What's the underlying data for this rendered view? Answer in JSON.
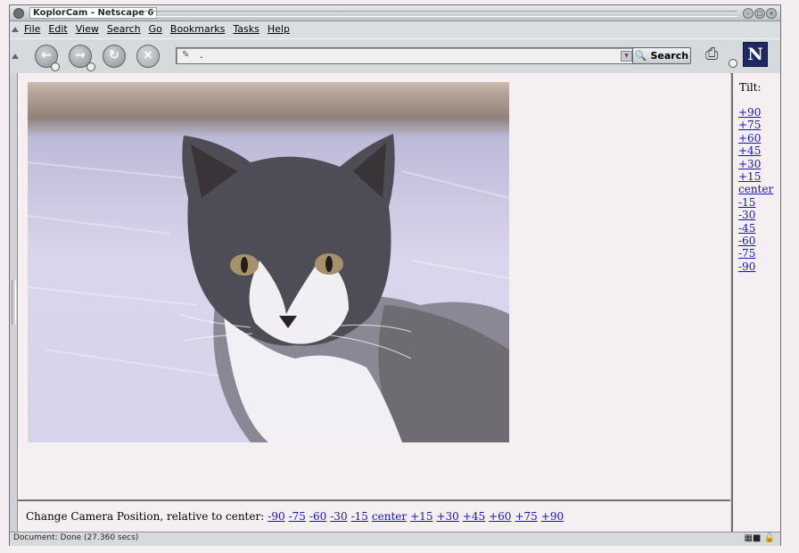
{
  "window": {
    "title": "KoplorCam - Netscape 6"
  },
  "menu": [
    "File",
    "Edit",
    "View",
    "Search",
    "Go",
    "Bookmarks",
    "Tasks",
    "Help"
  ],
  "toolbar": {
    "back": "back-arrow",
    "forward": "forward-arrow",
    "reload": "reload-icon",
    "stop": "stop-icon",
    "url_value": ".",
    "search_label": "Search"
  },
  "main": {
    "image_alt": "Webcam image of a gray and white cat"
  },
  "sidebar": {
    "tilt_label": "Tilt:",
    "tilts": [
      "+90",
      "+75",
      "+60",
      "+45",
      "+30",
      "+15",
      "center",
      "-15",
      "-30",
      "-45",
      "-60",
      "-75",
      "-90"
    ]
  },
  "bottom": {
    "label": "Change Camera Position, relative to center:",
    "pans": [
      "-90",
      "-75",
      "-60",
      "-30",
      "-15",
      "center",
      "+15",
      "+30",
      "+45",
      "+60",
      "+75",
      "+90"
    ]
  },
  "status": {
    "text": "Document: Done (27.360 secs)"
  },
  "colors": {
    "link": "#1515c8",
    "page_bg": "#f6eff2",
    "chrome": "#d7dadd"
  }
}
